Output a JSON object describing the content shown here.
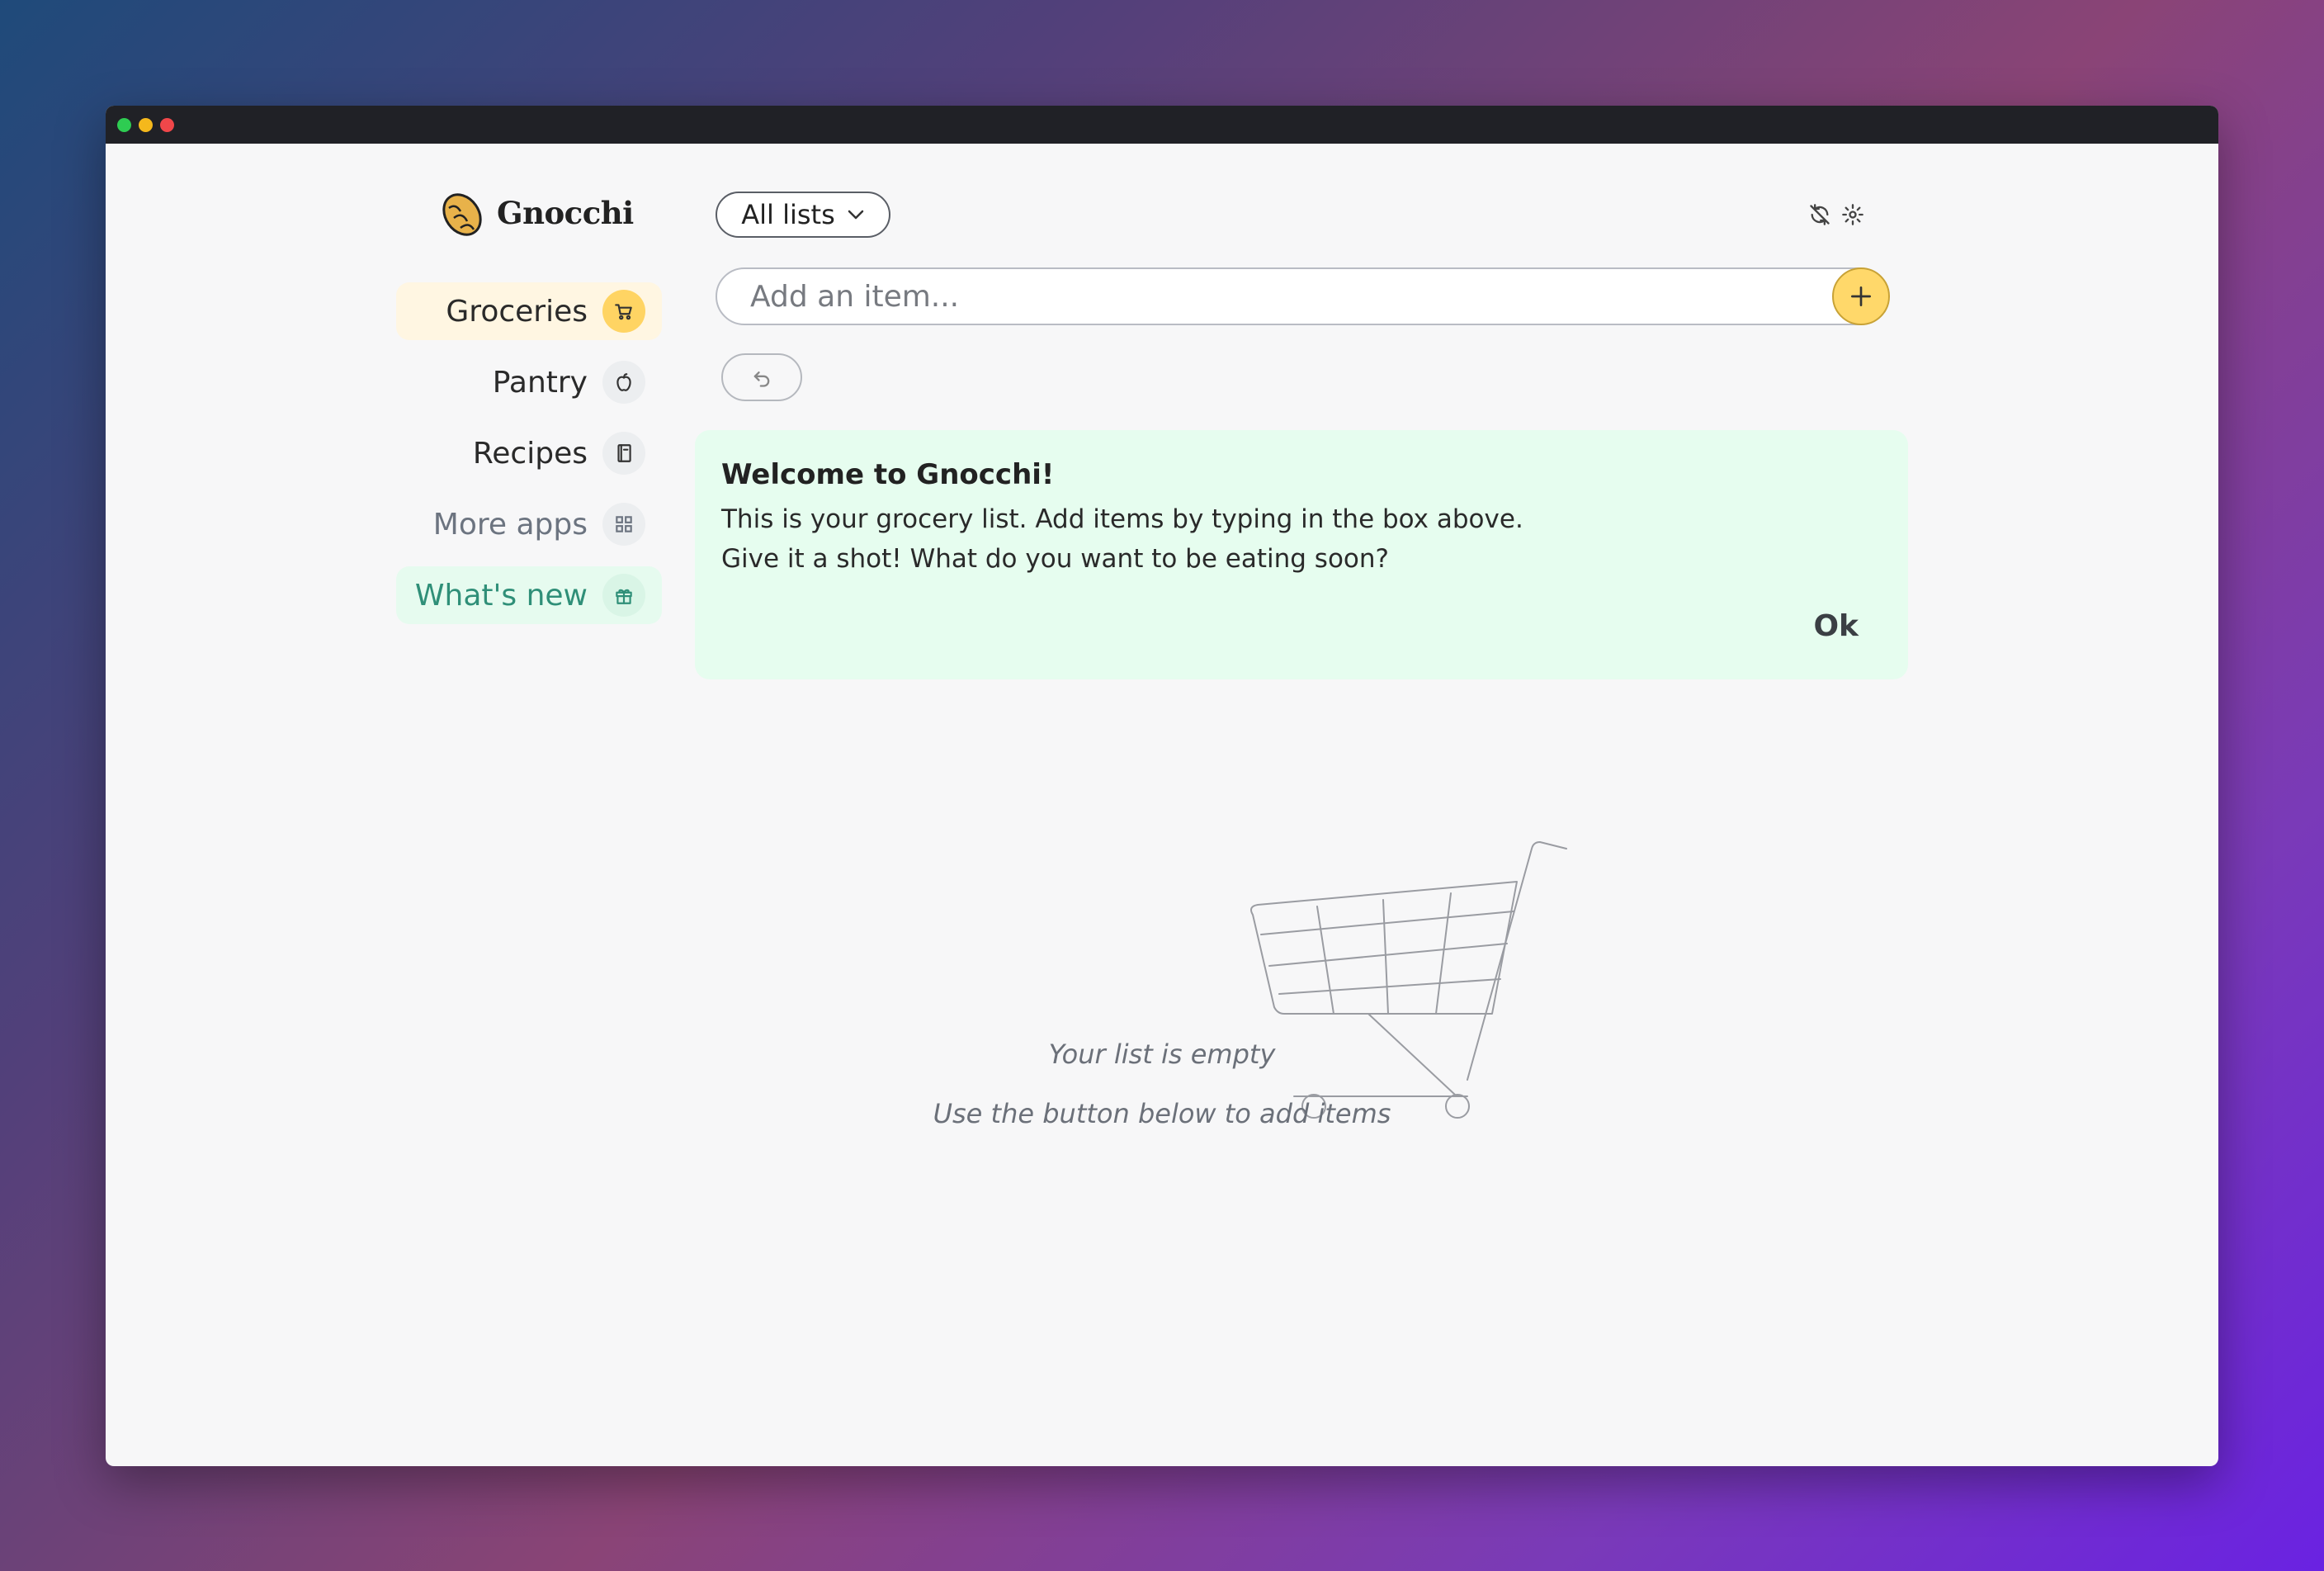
{
  "app": {
    "name": "Gnocchi"
  },
  "sidebar": {
    "items": [
      {
        "label": "Groceries",
        "icon": "cart-icon"
      },
      {
        "label": "Pantry",
        "icon": "apple-icon"
      },
      {
        "label": "Recipes",
        "icon": "book-icon"
      },
      {
        "label": "More apps",
        "icon": "grid-icon"
      },
      {
        "label": "What's new",
        "icon": "gift-icon"
      }
    ]
  },
  "header": {
    "list_select": {
      "value": "All lists"
    },
    "icons": [
      "sync-off-icon",
      "gear-icon"
    ]
  },
  "add_item": {
    "placeholder": "Add an item...",
    "button_icon": "plus-icon"
  },
  "undo": {
    "icon": "undo-icon"
  },
  "welcome": {
    "title": "Welcome to Gnocchi!",
    "line1": "This is your grocery list. Add items by typing in the box above.",
    "line2": "Give it a shot! What do you want to be eating soon?",
    "ok_label": "Ok"
  },
  "empty_state": {
    "title": "Your list is empty",
    "subtitle": "Use the button below to add items"
  },
  "colors": {
    "accent": "#ffd86a",
    "active_bg": "#fff6e2",
    "whats_new_text": "#2f8f78",
    "welcome_bg": "#e6fdef"
  }
}
